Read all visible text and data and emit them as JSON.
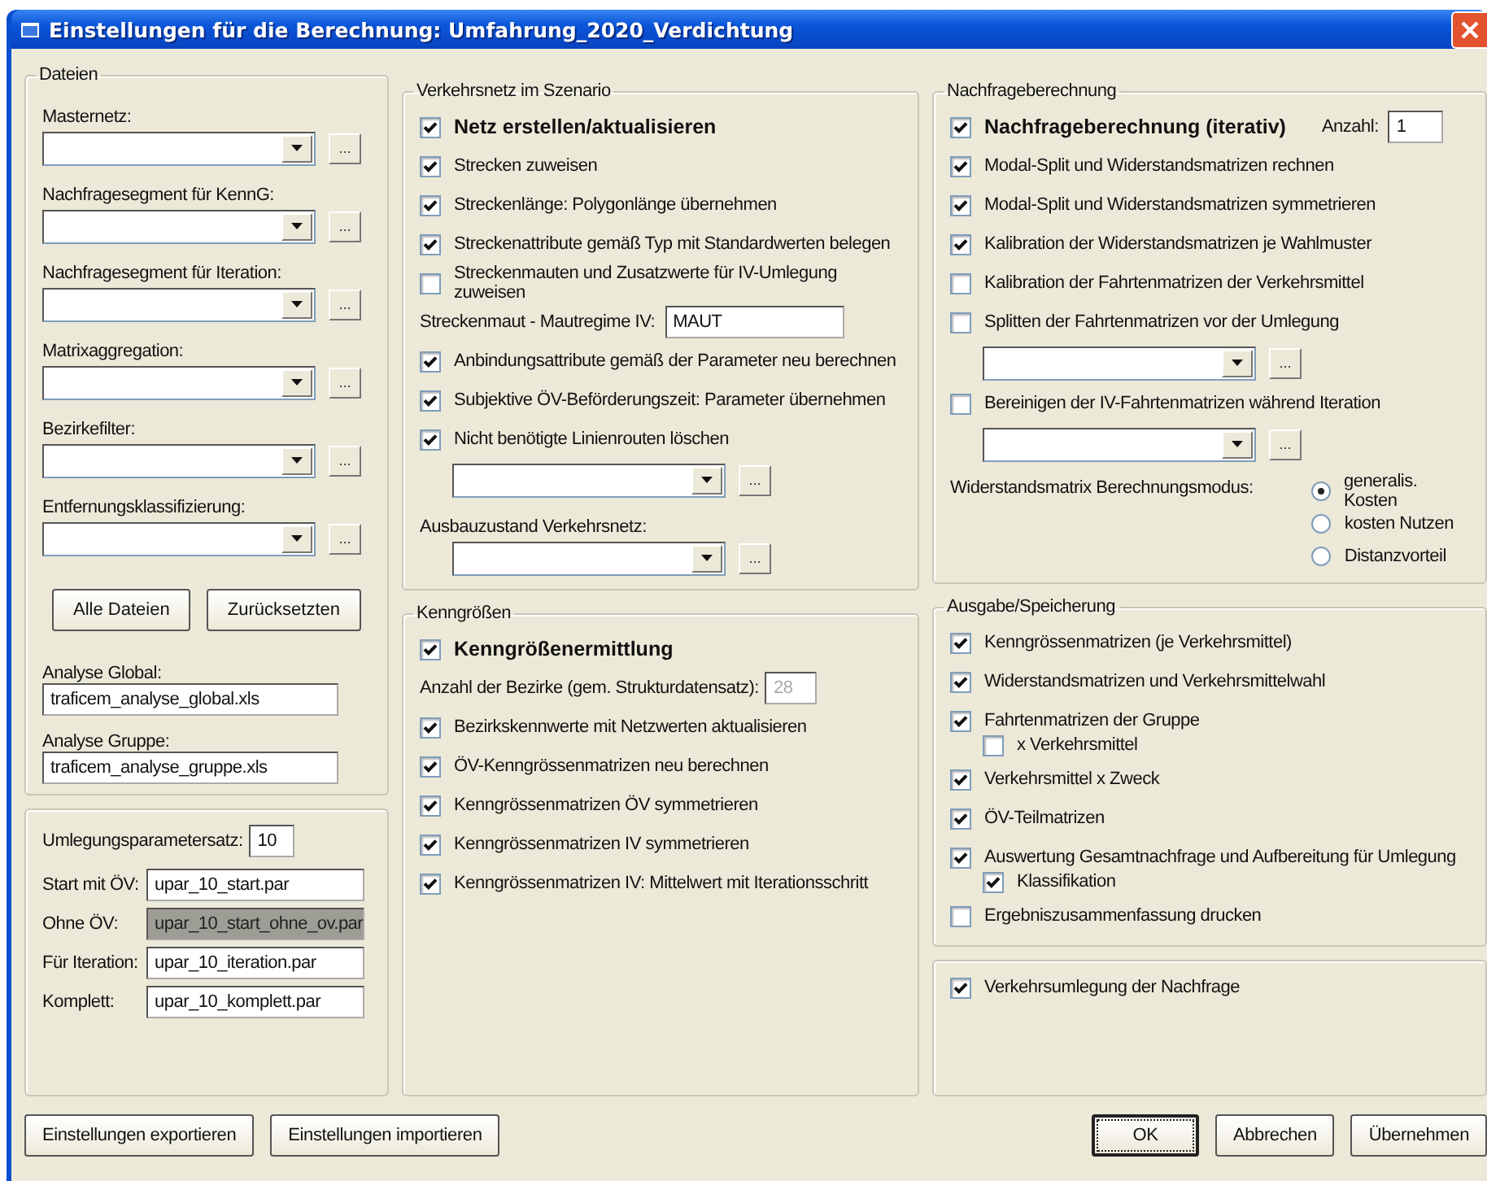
{
  "window": {
    "title": "Einstellungen für die Berechnung: Umfahrung_2020_Verdichtung"
  },
  "columns": [
    {
      "groups": [
        {
          "legend": "Dateien",
          "items": [
            {
              "kind": "combo",
              "label": "Masternetz:",
              "browse": "..."
            },
            {
              "kind": "combo",
              "label": "Nachfragesegment für KennG:",
              "browse": "..."
            },
            {
              "kind": "combo",
              "label": "Nachfragesegment für Iteration:",
              "browse": "..."
            },
            {
              "kind": "combo",
              "label": "Matrixaggregation:",
              "browse": "..."
            },
            {
              "kind": "combo",
              "label": " Bezirkefilter:",
              "browse": "..."
            },
            {
              "kind": "combo",
              "label": "Entfernungsklassifizierung:",
              "browse": "..."
            },
            {
              "kind": "buttons",
              "buttons": [
                "Alle Dateien",
                "Zurücksetzten"
              ]
            },
            {
              "kind": "text_field",
              "label": "Analyse Global:",
              "value": "traficem_analyse_global.xls"
            },
            {
              "kind": "text_field",
              "label": "Analyse Gruppe:",
              "value": "traficem_analyse_gruppe.xls"
            }
          ]
        },
        {
          "items": [
            {
              "kind": "short_field",
              "label": "Umlegungsparametersatz:",
              "value": "10",
              "disabled": false
            },
            {
              "kind": "inline_field",
              "label": "Start mit ÖV:",
              "value": "upar_10_start.par",
              "disabled": false
            },
            {
              "kind": "inline_field",
              "label": "Ohne ÖV:",
              "value": "upar_10_start_ohne_ov.par",
              "disabled": true
            },
            {
              "kind": "inline_field",
              "label": "Für Iteration:",
              "value": "upar_10_iteration.par",
              "disabled": false
            },
            {
              "kind": "inline_field",
              "label": "Komplett:",
              "value": "upar_10_komplett.par",
              "disabled": false
            }
          ]
        }
      ]
    },
    {
      "groups": [
        {
          "legend": "Verkehrsnetz im Szenario",
          "items": [
            {
              "kind": "heading_check",
              "label": "Netz erstellen/aktualisieren",
              "checked": true
            },
            {
              "kind": "check",
              "label": "Strecken zuweisen",
              "checked": true
            },
            {
              "kind": "check",
              "label": "Streckenlänge: Polygonlänge übernehmen",
              "checked": true
            },
            {
              "kind": "check",
              "label": "Streckenattribute gemäß Typ mit Standardwerten belegen",
              "checked": true
            },
            {
              "kind": "check",
              "label": "Streckenmauten und Zusatzwerte für IV-Umlegung zuweisen",
              "checked": false
            },
            {
              "kind": "short_field",
              "label": "Streckenmaut - Mautregime IV:",
              "value": "MAUT",
              "disabled": false
            },
            {
              "kind": "check",
              "label": "Anbindungsattribute gemäß der Parameter neu berechnen",
              "checked": true
            },
            {
              "kind": "check",
              "label": "Subjektive ÖV-Beförderungszeit: Parameter übernehmen",
              "checked": true
            },
            {
              "kind": "check",
              "label": "Nicht benötigte Linienrouten löschen",
              "checked": true
            },
            {
              "kind": "combo",
              "browse": "..."
            },
            {
              "kind": "combo",
              "label": "Ausbauzustand Verkehrsnetz:",
              "browse": "..."
            }
          ]
        },
        {
          "legend": "Kenngrößen",
          "items": [
            {
              "kind": "heading_check",
              "label": "Kenngrößenermittlung",
              "checked": true
            },
            {
              "kind": "short_field",
              "label": "Anzahl der Bezirke (gem. Strukturdatensatz):",
              "value": "28",
              "disabled": true
            },
            {
              "kind": "check",
              "label": "Bezirkskennwerte mit Netzwerten aktualisieren",
              "checked": true
            },
            {
              "kind": "check",
              "label": "ÖV-Kenngrössenmatrizen neu berechnen",
              "checked": true
            },
            {
              "kind": "check",
              "label": "Kenngrössenmatrizen ÖV symmetrieren",
              "checked": true
            },
            {
              "kind": "check",
              "label": "Kenngrössenmatrizen IV symmetrieren",
              "checked": true
            },
            {
              "kind": "check",
              "label": "Kenngrössenmatrizen IV: Mittelwert mit  Iterationsschritt",
              "checked": true
            }
          ]
        }
      ]
    },
    {
      "groups": [
        {
          "legend": "Nachfrageberechnung",
          "items": [
            {
              "kind": "heading_check",
              "label": "Nachfrageberechnung (iterativ)",
              "checked": true,
              "count_label": "Anzahl:",
              "count_value": "1"
            },
            {
              "kind": "check",
              "label": "Modal-Split und Widerstandsmatrizen rechnen",
              "checked": true
            },
            {
              "kind": "check",
              "label": "Modal-Split und Widerstandsmatrizen symmetrieren",
              "checked": true
            },
            {
              "kind": "check",
              "label": "Kalibration der Widerstandsmatrizen je Wahlmuster",
              "checked": true
            },
            {
              "kind": "check",
              "label": "Kalibration der Fahrtenmatrizen der Verkehrsmittel",
              "checked": false
            },
            {
              "kind": "check",
              "label": "Splitten der Fahrtenmatrizen vor der Umlegung",
              "checked": false
            },
            {
              "kind": "combo",
              "browse": "..."
            },
            {
              "kind": "check",
              "label": "Bereinigen der IV-Fahrtenmatrizen während Iteration",
              "checked": false
            },
            {
              "kind": "combo",
              "browse": "..."
            },
            {
              "kind": "radio_group",
              "label": "Widerstandsmatrix Berechnungsmodus:",
              "options": [
                {
                  "label": "generalis. Kosten",
                  "selected": true
                },
                {
                  "label": "kosten Nutzen",
                  "selected": false
                },
                {
                  "label": "Distanzvorteil",
                  "selected": false
                }
              ]
            }
          ]
        },
        {
          "legend": "Ausgabe/Speicherung",
          "items": [
            {
              "kind": "check",
              "label": "Kenngrössenmatrizen (je Verkehrsmittel)",
              "checked": true
            },
            {
              "kind": "check",
              "label": "Widerstandsmatrizen und Verkehrsmittelwahl",
              "checked": true
            },
            {
              "kind": "check",
              "label": "Fahrtenmatrizen der Gruppe",
              "checked": true
            },
            {
              "kind": "sub_check",
              "label": "x Verkehrsmittel",
              "checked": false
            },
            {
              "kind": "check",
              "label": "Verkehrsmittel x Zweck",
              "checked": true
            },
            {
              "kind": "check",
              "label": "ÖV-Teilmatrizen",
              "checked": true
            },
            {
              "kind": "check",
              "label": "Auswertung Gesamtnachfrage und Aufbereitung für Umlegung",
              "checked": true
            },
            {
              "kind": "sub_check",
              "label": "Klassifikation",
              "checked": true
            },
            {
              "kind": "check",
              "label": "Ergebniszusammenfassung drucken",
              "checked": false
            }
          ]
        },
        {
          "items": [
            {
              "kind": "check",
              "label": "Verkehrsumlegung der Nachfrage",
              "checked": true
            }
          ]
        }
      ]
    }
  ],
  "footer": {
    "left_buttons": [
      {
        "label": "Einstellungen exportieren",
        "default": false
      },
      {
        "label": "Einstellungen importieren",
        "default": false
      }
    ],
    "right_buttons": [
      {
        "label": "OK",
        "default": true
      },
      {
        "label": "Abbrechen",
        "default": false
      },
      {
        "label": "Übernehmen",
        "default": false
      }
    ]
  }
}
